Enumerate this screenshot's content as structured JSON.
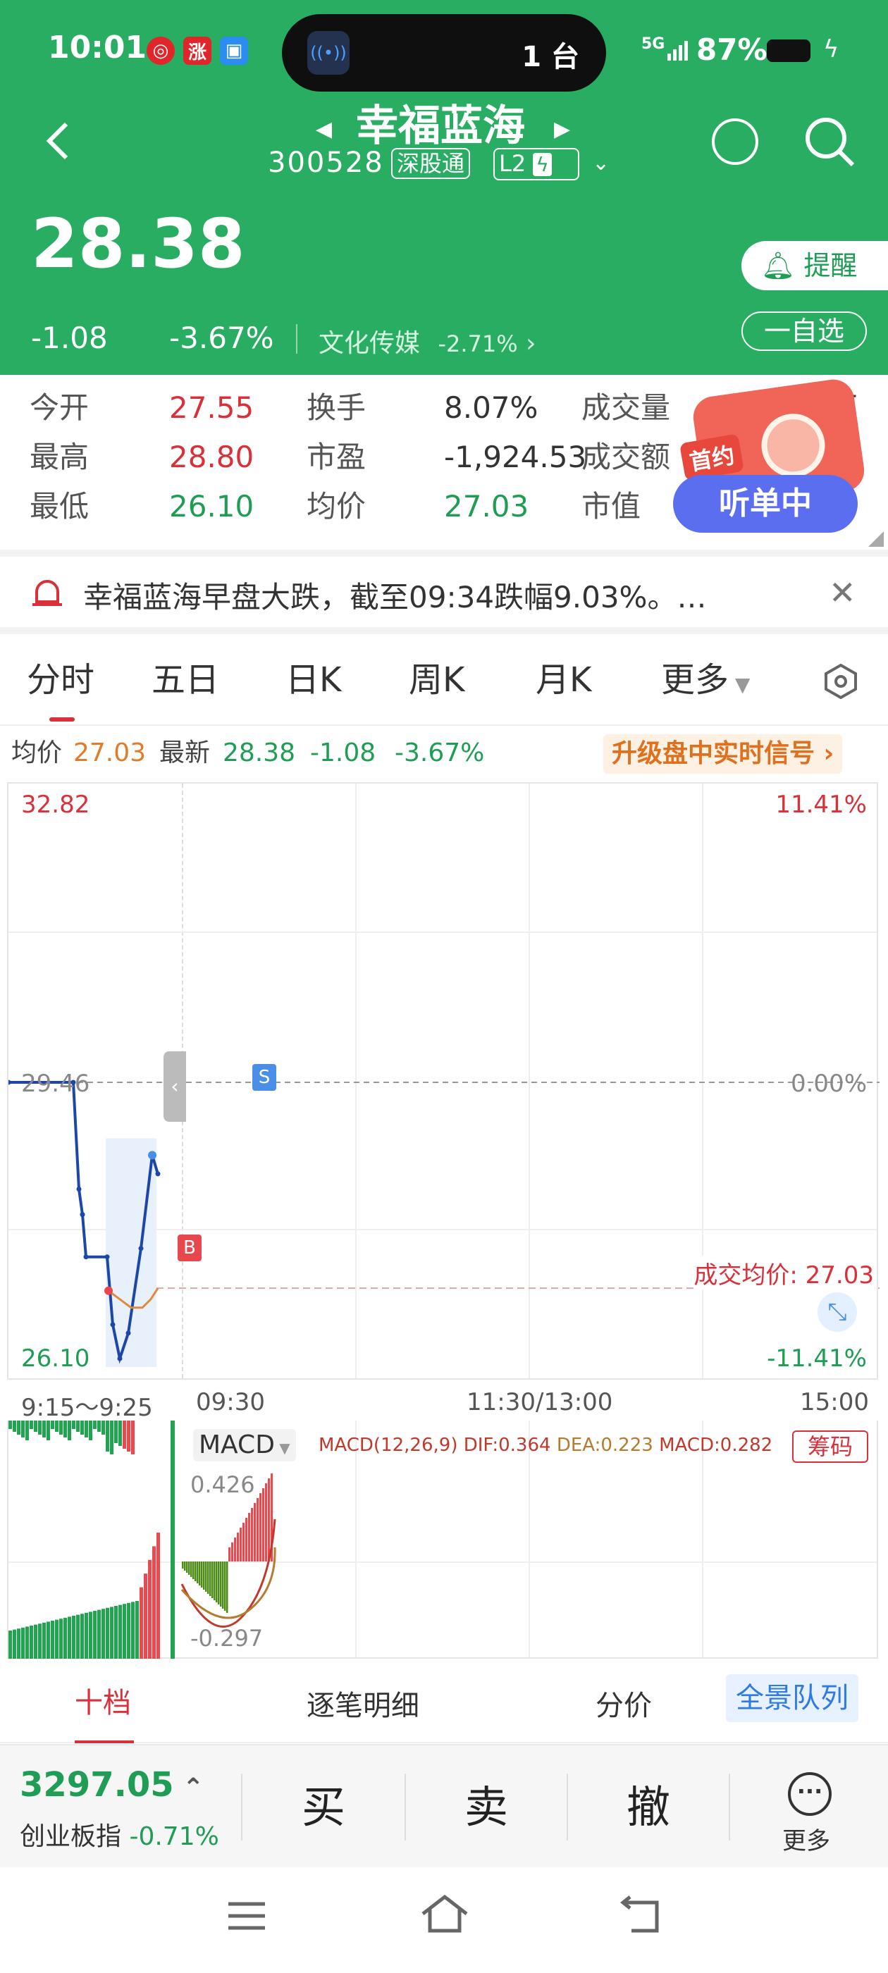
{
  "status_bar": {
    "time": "10:01",
    "island_text": "1 台",
    "signal": "5G",
    "battery": "87%",
    "app_icon_2": "涨"
  },
  "stock": {
    "name": "幸福蓝海",
    "code": "300528",
    "tag_connect": "深股通",
    "tag_level": "L2",
    "price": "28.38",
    "change": "-1.08",
    "change_pct": "-3.67%",
    "sector": "文化传媒",
    "sector_pct": "-2.71%",
    "remind_label": "提醒",
    "watchlist_label": "一自选"
  },
  "quotes": {
    "row1": {
      "l1": "今开",
      "v1": "27.55",
      "l2": "换手",
      "v2": "8.07%",
      "l3": "成交量",
      "v3": "万"
    },
    "row2": {
      "l1": "最高",
      "v1": "28.80",
      "l2": "市盈",
      "v2": "-1,924.53",
      "l3": "成交额",
      "v3": "亿"
    },
    "row3": {
      "l1": "最低",
      "v1": "26.10",
      "l2": "均价",
      "v2": "27.03",
      "l3": "市值",
      "v3": ""
    }
  },
  "promo": {
    "badge": "首约",
    "label": "听单中"
  },
  "news": {
    "text": "幸福蓝海早盘大跌，截至09:34跌幅9.03%。…"
  },
  "tabs": [
    "分时",
    "五日",
    "日K",
    "周K",
    "月K",
    "更多"
  ],
  "info": {
    "avg_label": "均价",
    "avg_value": "27.03",
    "latest_label": "最新",
    "latest_value": "28.38",
    "change": "-1.08",
    "change_pct": "-3.67%",
    "upgrade_label": "升级盘中实时信号 ›"
  },
  "chart": {
    "y_top": "32.82",
    "y_top_pct": "11.41%",
    "y_mid": "29.46",
    "y_mid_pct": "0.00%",
    "y_bottom": "26.10",
    "y_bottom_pct": "-11.41%",
    "avg_note": "成交均价: 27.03",
    "x_labels": [
      "9:15～9:25",
      "09:30",
      "11:30/13:00",
      "15:00"
    ],
    "marker_s": "S",
    "marker_b": "B"
  },
  "macd": {
    "label": "MACD",
    "params": "MACD(12,26,9)",
    "dif": "DIF:0.364",
    "dea": "DEA:0.223",
    "macd": "MACD:0.282",
    "chip_label": "筹码",
    "top_value": "0.426",
    "bottom_value": "-0.297"
  },
  "sub_tabs": [
    "十档",
    "逐笔明细",
    "分价",
    "全景队列"
  ],
  "index": {
    "value": "3297.05",
    "name": "创业板指",
    "pct": "-0.71%"
  },
  "actions": {
    "buy": "买",
    "sell": "卖",
    "cancel": "撤",
    "more": "更多"
  },
  "chart_data": {
    "type": "line",
    "title": "",
    "x": [
      "9:15～9:25",
      "09:30",
      "11:30/13:00",
      "15:00"
    ],
    "ylim": [
      26.1,
      32.82
    ],
    "series": [
      {
        "name": "价格",
        "values": [
          29.46,
          29.46,
          28.2,
          27.9,
          27.4,
          27.4,
          26.6,
          26.2,
          26.5,
          27.5,
          28.6,
          28.38
        ]
      },
      {
        "name": "均价",
        "values": [
          27.0,
          26.9,
          26.8,
          26.8,
          26.9,
          27.03
        ]
      }
    ],
    "reference": 29.46,
    "avg_price": 27.03
  }
}
